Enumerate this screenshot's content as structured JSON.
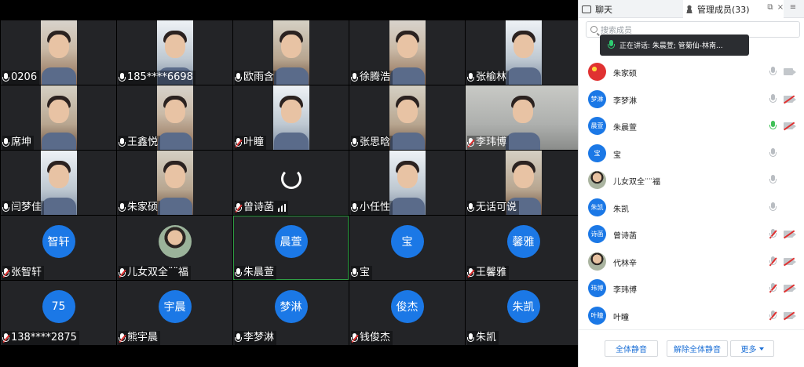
{
  "grid": {
    "tiles": [
      {
        "name": "0206",
        "type": "video",
        "mic": "on"
      },
      {
        "name": "185****6698",
        "type": "video",
        "mic": "on"
      },
      {
        "name": "欧雨含",
        "type": "video",
        "mic": "on"
      },
      {
        "name": "徐腾浩",
        "type": "video",
        "mic": "on"
      },
      {
        "name": "张榆林",
        "type": "video",
        "mic": "on"
      },
      {
        "name": "席坤",
        "type": "video",
        "mic": "on"
      },
      {
        "name": "王鑫悦",
        "type": "video",
        "mic": "on"
      },
      {
        "name": "叶瞳",
        "type": "video",
        "mic": "muted"
      },
      {
        "name": "张思晗",
        "type": "video",
        "mic": "on"
      },
      {
        "name": "李玮博",
        "type": "video",
        "mic": "muted"
      },
      {
        "name": "闫梦佳",
        "type": "video",
        "mic": "on"
      },
      {
        "name": "朱家硕",
        "type": "video",
        "mic": "on"
      },
      {
        "name": "曾诗菡",
        "type": "loading",
        "mic": "muted"
      },
      {
        "name": "小任性",
        "type": "video",
        "mic": "on"
      },
      {
        "name": "无话可说",
        "type": "video",
        "mic": "on"
      },
      {
        "name": "张智轩",
        "type": "avatar",
        "avatar": "智轩",
        "mic": "muted"
      },
      {
        "name": "儿女双全¨¨福",
        "type": "photo",
        "mic": "muted"
      },
      {
        "name": "朱晨萱",
        "type": "avatar",
        "avatar": "晨萱",
        "mic": "on"
      },
      {
        "name": "宝",
        "type": "avatar",
        "avatar": "宝",
        "mic": "on"
      },
      {
        "name": "王馨雅",
        "type": "avatar",
        "avatar": "馨雅",
        "mic": "muted"
      },
      {
        "name": "138****2875",
        "type": "avatar",
        "avatar": "75",
        "mic": "muted"
      },
      {
        "name": "熊宇晨",
        "type": "avatar",
        "avatar": "宇晨",
        "mic": "muted"
      },
      {
        "name": "李梦淋",
        "type": "avatar",
        "avatar": "梦淋",
        "mic": "on"
      },
      {
        "name": "钱俊杰",
        "type": "avatar",
        "avatar": "俊杰",
        "mic": "muted"
      },
      {
        "name": "朱凯",
        "type": "avatar",
        "avatar": "朱凯",
        "mic": "on"
      }
    ]
  },
  "panel": {
    "tab_chat": "聊天",
    "tab_members": "管理成员(33)",
    "search_placeholder": "搜索成员",
    "speaking_tip": "正在讲话: 朱晨萱; 管菊仙-林南...",
    "members": [
      {
        "name": "朱家硕",
        "avatar": "",
        "avatar_type": "flag",
        "mic": "on",
        "cam": "on"
      },
      {
        "name": "李梦淋",
        "avatar": "梦淋",
        "avatar_type": "text",
        "mic": "on",
        "cam": "off"
      },
      {
        "name": "朱晨萱",
        "avatar": "晨萱",
        "avatar_type": "text",
        "mic": "speaking",
        "cam": "off"
      },
      {
        "name": "宝",
        "avatar": "宝",
        "avatar_type": "text",
        "mic": "on",
        "cam": "none"
      },
      {
        "name": "儿女双全¨¨福",
        "avatar": "",
        "avatar_type": "photo",
        "mic": "on",
        "cam": "none"
      },
      {
        "name": "朱凯",
        "avatar": "朱凯",
        "avatar_type": "text",
        "mic": "on",
        "cam": "none"
      },
      {
        "name": "曾诗菡",
        "avatar": "诗菡",
        "avatar_type": "text",
        "mic": "muted",
        "cam": "off"
      },
      {
        "name": "代林辛",
        "avatar": "",
        "avatar_type": "photo",
        "mic": "muted",
        "cam": "off"
      },
      {
        "name": "李玮博",
        "avatar": "玮博",
        "avatar_type": "text",
        "mic": "muted",
        "cam": "off"
      },
      {
        "name": "叶瞳",
        "avatar": "叶瞳",
        "avatar_type": "text",
        "mic": "muted",
        "cam": "off"
      }
    ],
    "footer": {
      "mute_all": "全体静音",
      "unmute_all": "解除全体静音",
      "more": "更多"
    }
  },
  "colors": {
    "avatar_blue": "#1b78e6",
    "tile_bg": "#232427",
    "muted_red": "#e03131",
    "speaking_green": "#40c057",
    "link_blue": "#1b6fd6"
  }
}
